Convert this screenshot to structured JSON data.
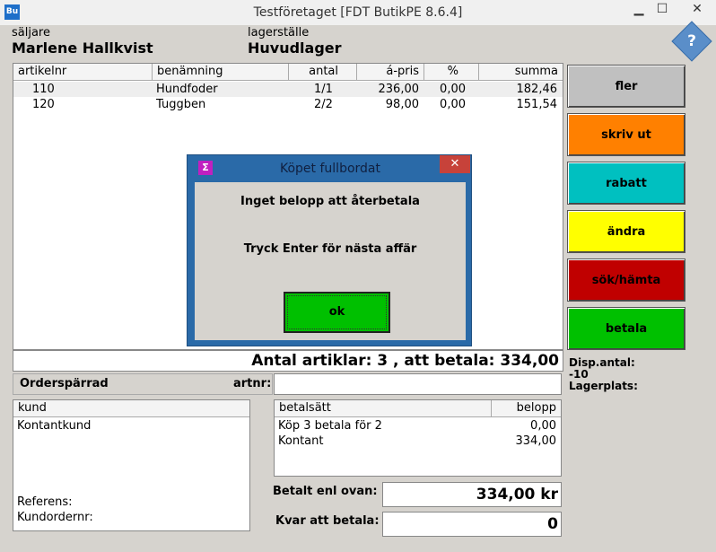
{
  "window": {
    "app_icon": "Bu",
    "title": "Testföretaget [FDT ButikPE 8.6.4]",
    "minimize_glyph": "▁",
    "maximize_glyph": "☐",
    "close_glyph": "✕"
  },
  "header": {
    "seller_label": "säljare",
    "seller_name": "Marlene Hallkvist",
    "location_label": "lagerställe",
    "location_name": "Huvudlager",
    "help_glyph": "?"
  },
  "items_table": {
    "columns": [
      "artikelnr",
      "benämning",
      "antal",
      "á-pris",
      "%",
      "summa"
    ],
    "rows": [
      {
        "artikelnr": "110",
        "benamning": "Hundfoder",
        "antal": "1/1",
        "apris": "236,00",
        "pct": "0,00",
        "summa": "182,46"
      },
      {
        "artikelnr": "120",
        "benamning": "Tuggben",
        "antal": "2/2",
        "apris": "98,00",
        "pct": "0,00",
        "summa": "151,54"
      }
    ]
  },
  "total": {
    "text": "Antal artiklar: 3 , att betala: 334,00"
  },
  "side_buttons": [
    {
      "label": "fler",
      "color": "#c0c0c0"
    },
    {
      "label": "skriv ut",
      "color": "#ff8000"
    },
    {
      "label": "rabatt",
      "color": "#00c0c0"
    },
    {
      "label": "ändra",
      "color": "#ffff00"
    },
    {
      "label": "sök/hämta",
      "color": "#c00000"
    },
    {
      "label": "betala",
      "color": "#00c000"
    }
  ],
  "side_info": {
    "disp_label": "Disp.antal:",
    "disp_value": "-10",
    "lagerplats_label": "Lagerplats:"
  },
  "order": {
    "orderspärrad": "Orderspärrad",
    "artnr_label": "artnr:"
  },
  "customer": {
    "header": "kund",
    "name": "Kontantkund",
    "referens_label": "Referens:",
    "kundordernr_label": "Kundordernr:"
  },
  "payment": {
    "col_method": "betalsätt",
    "col_amount": "belopp",
    "rows": [
      {
        "method": "Köp 3 betala för 2",
        "amount": "0,00"
      },
      {
        "method": "Kontant",
        "amount": "334,00"
      }
    ]
  },
  "summary": {
    "paid_label": "Betalt enl ovan:",
    "paid_value": "334,00 kr",
    "remaining_label": "Kvar att betala:",
    "remaining_value": "0"
  },
  "dialog": {
    "icon": "Σ",
    "title": "Köpet fullbordat",
    "close_glyph": "✕",
    "line1": "Inget belopp att återbetala",
    "line2": "Tryck Enter för nästa affär",
    "ok_label": "ok"
  }
}
